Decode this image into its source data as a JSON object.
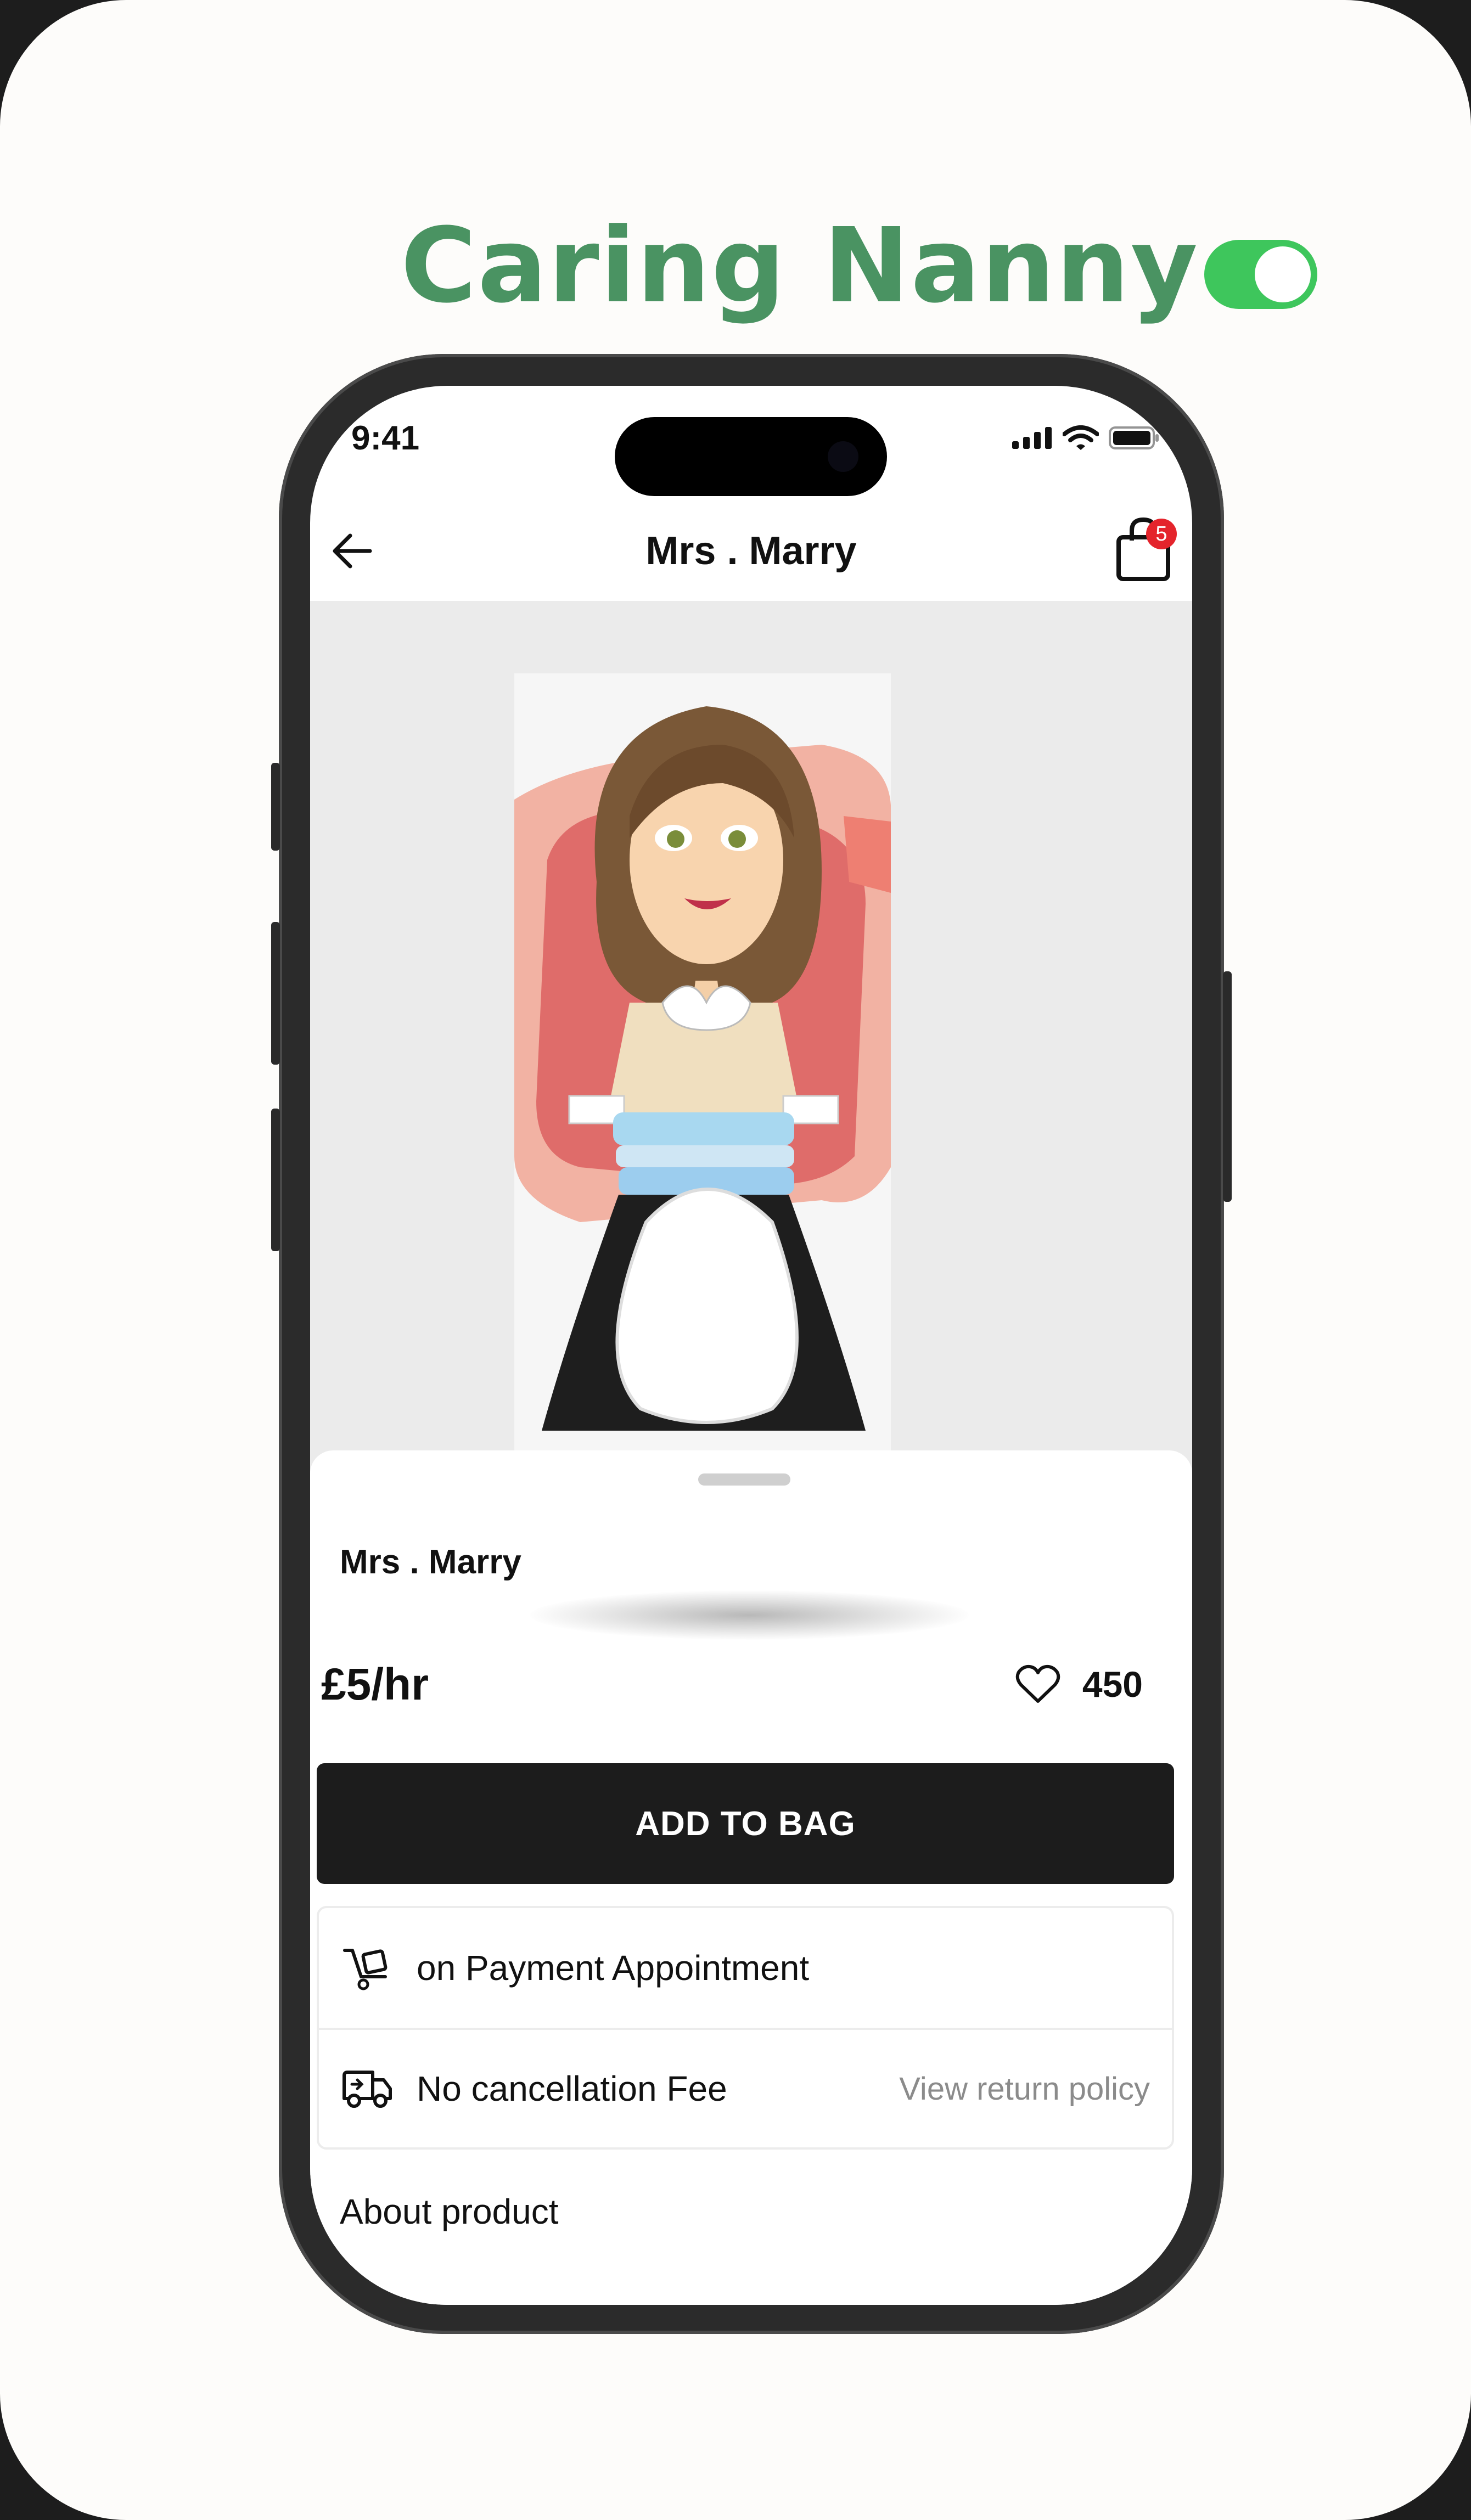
{
  "brand": {
    "title": "Caring Nanny",
    "toggle_on": true,
    "toggle_color": "#3ec65c",
    "title_color": "#4a9362"
  },
  "status_bar": {
    "time": "9:41"
  },
  "header": {
    "title": "Mrs . Marry",
    "bag_badge": "5"
  },
  "product": {
    "name": "Mrs . Marry",
    "price": "£5/hr",
    "likes": "450",
    "add_button": "ADD TO BAG",
    "info": [
      {
        "icon": "trolley-icon",
        "text": "on Payment Appointment"
      },
      {
        "icon": "delivery-truck-icon",
        "text": "No cancellation Fee",
        "link": "View return policy"
      }
    ],
    "about_label": "About product"
  },
  "colors": {
    "accent_dark": "#1c1c1c",
    "badge": "#e4242c",
    "hero_bg": "#ebebeb"
  }
}
